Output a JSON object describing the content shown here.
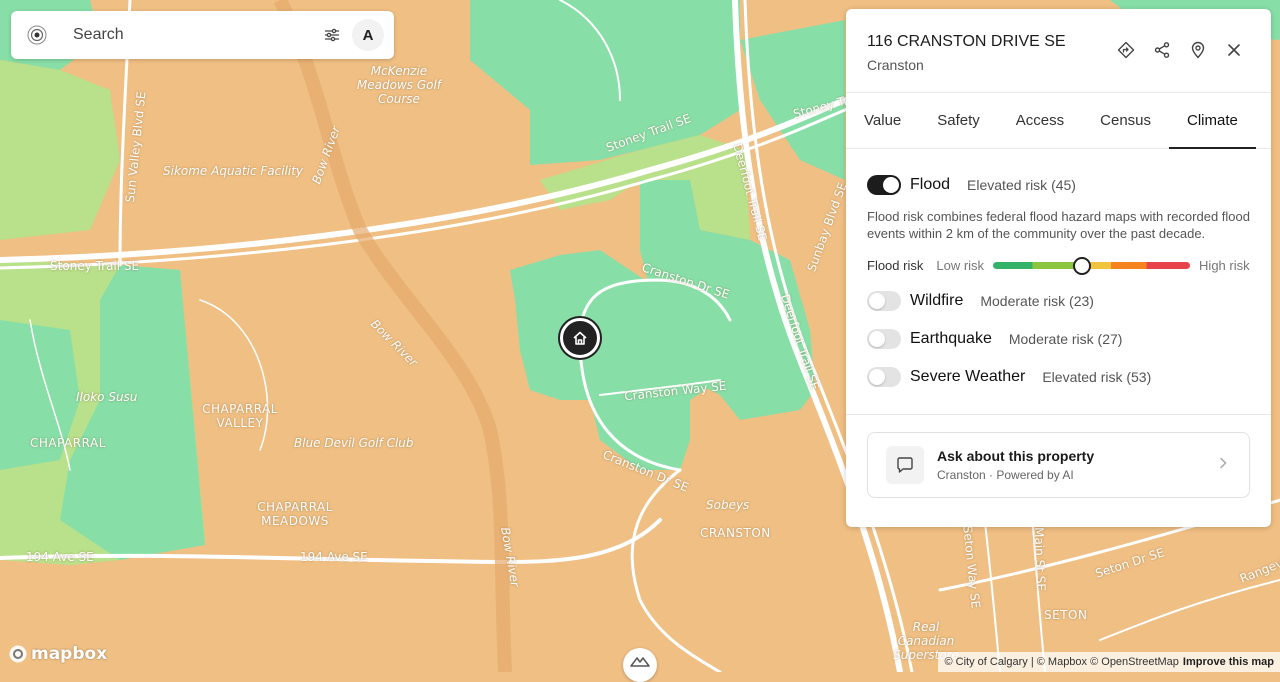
{
  "search": {
    "placeholder": "Search",
    "avatar_letter": "A"
  },
  "property": {
    "address": "116 CRANSTON DRIVE SE",
    "community": "Cranston"
  },
  "tabs": [
    {
      "label": "Value"
    },
    {
      "label": "Safety"
    },
    {
      "label": "Access"
    },
    {
      "label": "Census"
    },
    {
      "label": "Climate",
      "active": true
    }
  ],
  "climate": {
    "flood": {
      "name": "Flood",
      "level": "Elevated risk (45)",
      "enabled": true
    },
    "description": "Flood risk combines federal flood hazard maps with recorded flood events within 2 km of the community over the past decade.",
    "scale": {
      "label": "Flood risk",
      "low": "Low risk",
      "high": "High risk",
      "value": 45
    },
    "others": [
      {
        "name": "Wildfire",
        "level": "Moderate risk (23)",
        "enabled": false
      },
      {
        "name": "Earthquake",
        "level": "Moderate risk (27)",
        "enabled": false
      },
      {
        "name": "Severe Weather",
        "level": "Elevated risk (53)",
        "enabled": false
      }
    ]
  },
  "ask": {
    "title": "Ask about this property",
    "subtitle": "Cranston · Powered by AI"
  },
  "map": {
    "labels": {
      "mckenzie": "McKenzie Meadows Golf Course",
      "sikome": "Sikome Aquatic Facility",
      "stoney1": "Stoney Trail SE",
      "stoney2": "Stoney Trail SE",
      "stoney3": "Stoney Trail SE",
      "sunvalley": "Sun Valley Blvd SE",
      "bowriver1": "Bow River",
      "bowriver2": "Bow River",
      "bowriver3": "Bow River",
      "deerfoot1": "Deerfoot Trail SE",
      "deerfoot2": "Deerfoot Trail SE",
      "cranstondr1": "Cranston Dr SE",
      "cranstondr2": "Cranston Dr SE",
      "cranstonway": "Cranston Way SE",
      "sunbay": "Sunbay Blvd SE",
      "iloko": "Iloko Susu",
      "chaparral": "CHAPARRAL",
      "chaparral_valley": "CHAPARRAL VALLEY",
      "chaparral_meadows": "CHAPARRAL MEADOWS",
      "bluedevil": "Blue Devil Golf Club",
      "ave194a": "194 Ave SE",
      "ave194b": "194 Ave SE",
      "sobeys": "Sobeys",
      "cranston": "CRANSTON",
      "setonway": "Seton Way SE",
      "mainst": "Main St SE",
      "setondr": "Seton Dr SE",
      "seton": "SETON",
      "realcanadian": "Real Canadian Superstore",
      "rangeview": "Rangeview"
    },
    "colors": {
      "base": "#f0bf83",
      "low": "#87dfa7",
      "lowmod": "#b9e08a"
    }
  },
  "attribution": {
    "text": "© City of Calgary | © Mapbox © OpenStreetMap",
    "improve": "Improve this map",
    "logo": "mapbox"
  }
}
